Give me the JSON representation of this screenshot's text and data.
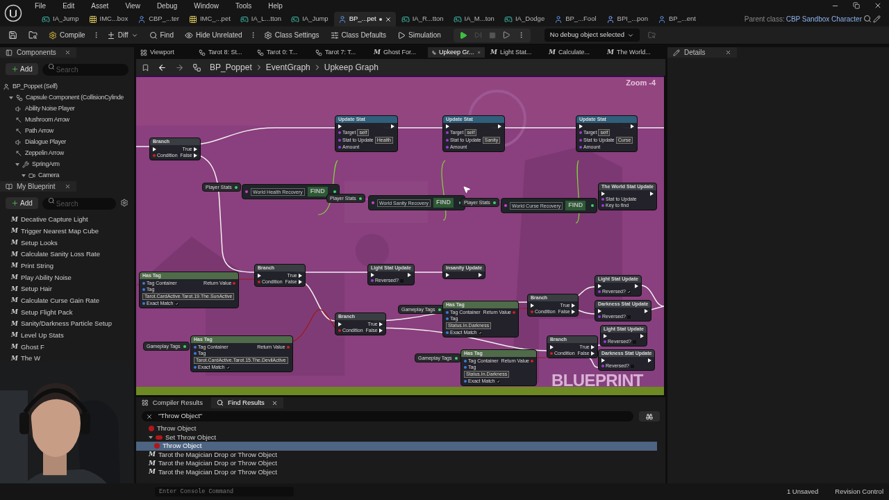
{
  "menu": [
    "File",
    "Edit",
    "Asset",
    "View",
    "Debug",
    "Window",
    "Tools",
    "Help"
  ],
  "asset_tabs": [
    {
      "label": "IA_Jump",
      "kind": "input",
      "selected": false,
      "modified": false
    },
    {
      "label": "IMC...box",
      "kind": "mapping",
      "selected": false,
      "modified": false
    },
    {
      "label": "CBP_...ter",
      "kind": "character",
      "selected": false,
      "modified": false
    },
    {
      "label": "IMC_...pet",
      "kind": "mapping",
      "selected": false,
      "modified": false
    },
    {
      "label": "IA_L...tton",
      "kind": "input",
      "selected": false,
      "modified": false
    },
    {
      "label": "IA_Jump",
      "kind": "input",
      "selected": false,
      "modified": false
    },
    {
      "label": "BP_...pet",
      "kind": "character",
      "selected": true,
      "modified": true
    },
    {
      "label": "IA_R...tton",
      "kind": "input",
      "selected": false,
      "modified": false
    },
    {
      "label": "IA_M...ton",
      "kind": "input",
      "selected": false,
      "modified": false
    },
    {
      "label": "IA_Dodge",
      "kind": "input",
      "selected": false,
      "modified": false
    },
    {
      "label": "BP_...Fool",
      "kind": "character",
      "selected": false,
      "modified": false
    },
    {
      "label": "BPI_...pon",
      "kind": "interface",
      "selected": false,
      "modified": false
    },
    {
      "label": "BP_...ent",
      "kind": "character",
      "selected": false,
      "modified": false
    }
  ],
  "parent_class": {
    "label": "Parent class:",
    "value": "CBP Sandbox Character"
  },
  "toolbar": {
    "compile": "Compile",
    "diff": "Diff",
    "find": "Find",
    "hide_unrelated": "Hide Unrelated",
    "class_settings": "Class Settings",
    "class_defaults": "Class Defaults",
    "simulation": "Simulation",
    "debug_object": "No debug object selected"
  },
  "components": {
    "title": "Components",
    "add": "Add",
    "search_placeholder": "Search",
    "tree": [
      {
        "label": "BP_Poppet (Self)",
        "kind": "self",
        "children": [
          {
            "label": "Capsule Component (CollisionCylinde",
            "kind": "capsule",
            "expanded": true,
            "children": [
              {
                "label": "Ability Noise Player",
                "kind": "audio"
              },
              {
                "label": "Mushroom Arrow",
                "kind": "arrow"
              },
              {
                "label": "Path Arrow",
                "kind": "arrow"
              },
              {
                "label": "Dialogue Player",
                "kind": "audio"
              },
              {
                "label": "Zeppelin Arrow",
                "kind": "arrow"
              },
              {
                "label": "SpringArm",
                "kind": "springarm",
                "expanded": true,
                "children": [
                  {
                    "label": "Camera",
                    "kind": "camera",
                    "expanded": true
                  }
                ]
              }
            ]
          }
        ]
      }
    ]
  },
  "my_blueprint": {
    "title": "My Blueprint",
    "add": "Add",
    "search_placeholder": "Search",
    "functions": [
      {
        "icon": "M",
        "label": "Decative Capture Light"
      },
      {
        "icon": "M",
        "label": "Trigger Nearest Map Cube"
      },
      {
        "icon": "M",
        "label": "Setup Looks"
      },
      {
        "icon": "M",
        "label": "Calculate Sanity Loss Rate"
      },
      {
        "icon": "M",
        "label": "Print String"
      },
      {
        "icon": "M",
        "label": "Play Ability Noise"
      },
      {
        "icon": "M",
        "label": "Setup Hair"
      },
      {
        "icon": "M",
        "label": "Calculate Curse Gain Rate"
      },
      {
        "icon": "M",
        "label": "Setup Flight Pack"
      },
      {
        "icon": "M",
        "label": "Sanity/Darkness Particle Setup"
      },
      {
        "icon": "M",
        "label": "Level Up Stats"
      },
      {
        "icon": "M",
        "label": "Ghost F"
      },
      {
        "icon": "M",
        "label": "The W"
      }
    ]
  },
  "webcam": {
    "kind": "picture"
  },
  "doc_tabs": [
    {
      "label": "Viewport",
      "kind": "viewport",
      "selected": false
    },
    {
      "label": "Tarot 8: St...",
      "kind": "graph",
      "selected": false
    },
    {
      "label": "Tarot 0: T...",
      "kind": "graph",
      "selected": false
    },
    {
      "label": "Tarot 7: T...",
      "kind": "graph",
      "selected": false
    },
    {
      "label": "Ghost For...",
      "kind": "function",
      "icon": "M",
      "selected": false
    },
    {
      "label": "Upkeep Gr...",
      "kind": "graph",
      "selected": true
    },
    {
      "label": "Light Stat...",
      "kind": "function",
      "icon": "M",
      "selected": false
    },
    {
      "label": "Calculate...",
      "kind": "function",
      "icon": "M",
      "selected": false
    },
    {
      "label": "The World...",
      "kind": "function",
      "icon": "M",
      "selected": false
    }
  ],
  "breadcrumb": [
    "BP_Poppet",
    "EventGraph",
    "Upkeep Graph"
  ],
  "graph": {
    "zoom": "Zoom -4",
    "watermark": "BLUEPRINT",
    "nodes": [
      {
        "kind": "branch",
        "title": "Branch",
        "rows": [
          {
            "right": "True"
          },
          {
            "left": "Condition",
            "right": "False"
          }
        ]
      },
      {
        "kind": "call",
        "title": "Update Stat",
        "rows": [
          {
            "left": "Target",
            "value": "self"
          },
          {
            "left": "Stat to Update",
            "value": "Health"
          },
          {
            "left": "Amount"
          }
        ]
      },
      {
        "kind": "call",
        "title": "Update Stat",
        "rows": [
          {
            "left": "Target",
            "value": "self"
          },
          {
            "left": "Stat to Update",
            "value": "Sanity"
          },
          {
            "left": "Amount"
          }
        ]
      },
      {
        "kind": "call",
        "title": "Update Stat",
        "rows": [
          {
            "left": "Target",
            "value": "self"
          },
          {
            "left": "Stat to Update",
            "value": "Curse"
          },
          {
            "left": "Amount"
          }
        ]
      },
      {
        "kind": "var",
        "title": "Player Stats"
      },
      {
        "kind": "find",
        "title": "FIND",
        "rows": [
          {
            "value": "World Health Recovery"
          }
        ]
      },
      {
        "kind": "var",
        "title": "Player Stats"
      },
      {
        "kind": "find",
        "title": "FIND",
        "rows": [
          {
            "value": "World Sanity Recovery"
          }
        ]
      },
      {
        "kind": "var",
        "title": "Player Stats"
      },
      {
        "kind": "find",
        "title": "FIND",
        "rows": [
          {
            "value": "World Curse Recovery"
          }
        ]
      },
      {
        "kind": "macro",
        "title": "The World Stat Update",
        "rows": [
          {
            "left": "Stat to Update"
          },
          {
            "left": "Key to find"
          }
        ]
      },
      {
        "kind": "hastag",
        "title": "Has Tag",
        "rows": [
          {
            "left": "Tag Container",
            "right": "Return Value"
          },
          {
            "left": "Tag"
          },
          {
            "value": "Tarot.CardActive.Tarot.19.The.SunActive"
          },
          {
            "left": "Exact Match",
            "checked": true
          }
        ]
      },
      {
        "kind": "branch",
        "title": "Branch",
        "rows": [
          {
            "right": "True"
          },
          {
            "left": "Condition",
            "right": "False"
          }
        ]
      },
      {
        "kind": "macro",
        "title": "Light Stat Update",
        "rows": [
          {
            "left": "Reversed?",
            "checked": false
          }
        ]
      },
      {
        "kind": "macro",
        "title": "Insanity Update"
      },
      {
        "kind": "branch",
        "title": "Branch",
        "rows": [
          {
            "right": "True"
          },
          {
            "left": "Condition",
            "right": "False"
          }
        ]
      },
      {
        "kind": "var",
        "title": "Gameplay Tags"
      },
      {
        "kind": "hastag",
        "title": "Has Tag",
        "rows": [
          {
            "left": "Tag Container",
            "right": "Return Value"
          },
          {
            "left": "Tag"
          },
          {
            "value": "Tarot.CardActive.Tarot.15.The.DevilActive"
          },
          {
            "left": "Exact Match",
            "checked": true
          }
        ]
      },
      {
        "kind": "var",
        "title": "Gameplay Tags"
      },
      {
        "kind": "hastag",
        "title": "Has Tag",
        "rows": [
          {
            "left": "Tag Container",
            "right": "Return Value"
          },
          {
            "left": "Tag"
          },
          {
            "value": "Status.In.Darkness"
          },
          {
            "left": "Exact Match",
            "checked": true
          }
        ]
      },
      {
        "kind": "branch",
        "title": "Branch",
        "rows": [
          {
            "right": "True"
          },
          {
            "left": "Condition",
            "right": "False"
          }
        ]
      },
      {
        "kind": "macro",
        "title": "Light Stat Update",
        "rows": [
          {
            "left": "Reversed?",
            "checked": true
          }
        ]
      },
      {
        "kind": "macro",
        "title": "Darkness Stat Update",
        "rows": [
          {
            "left": "Reversed?",
            "checked": false
          }
        ]
      },
      {
        "kind": "var",
        "title": "Gameplay Tags"
      },
      {
        "kind": "hastag",
        "title": "Has Tag",
        "rows": [
          {
            "left": "Tag Container",
            "right": "Return Value"
          },
          {
            "left": "Tag"
          },
          {
            "value": "Status.In.Darkness"
          },
          {
            "left": "Exact Match",
            "checked": true
          }
        ]
      },
      {
        "kind": "branch",
        "title": "Branch",
        "rows": [
          {
            "right": "True"
          },
          {
            "left": "Condition",
            "right": "False"
          }
        ]
      },
      {
        "kind": "macro",
        "title": "Light Stat Update",
        "rows": [
          {
            "left": "Reversed?",
            "checked": false
          }
        ]
      },
      {
        "kind": "macro",
        "title": "Darkness Stat Update",
        "rows": [
          {
            "left": "Reversed?",
            "checked": false
          }
        ]
      }
    ]
  },
  "details": {
    "title": "Details"
  },
  "bottom_tabs": [
    {
      "label": "Compiler Results",
      "kind": "compiler",
      "selected": false
    },
    {
      "label": "Find Results",
      "kind": "find",
      "selected": true
    }
  ],
  "find_query": "\"Throw Object\"",
  "results": [
    {
      "label": "Throw Object",
      "kind": "variable",
      "selected": false
    },
    {
      "label": "Set Throw Object",
      "kind": "set",
      "selected": false,
      "expanded": true,
      "children": [
        {
          "label": "Throw Object",
          "kind": "variable",
          "selected": true
        }
      ]
    },
    {
      "label": "Tarot the Magician Drop or Throw Object",
      "kind": "function",
      "icon": "M",
      "selected": false
    },
    {
      "label": "Tarot the Magician Drop or Throw Object",
      "kind": "function",
      "icon": "M",
      "selected": false
    },
    {
      "label": "Tarot the Magician Drop or Throw Object",
      "kind": "function",
      "icon": "M",
      "selected": false
    }
  ],
  "status_bar": {
    "console_placeholder": "Enter Console Command",
    "unsaved": "1 Unsaved",
    "revision": "Revision Control"
  }
}
